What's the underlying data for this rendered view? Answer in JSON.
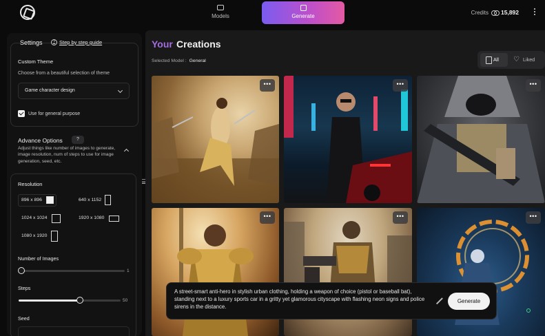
{
  "topbar": {
    "models_label": "Models",
    "generate_label": "Generate",
    "credits_label": "Credits",
    "credits_value": "15,892"
  },
  "sidebar": {
    "title": "Settings",
    "guide_link": "Step by step guide",
    "custom_theme": {
      "title": "Custom Theme",
      "subtitle": "Choose from a beautiful selection of theme",
      "selected": "Game character design",
      "checkbox_label": "Use for general purpose",
      "checkbox_checked": true
    },
    "advance": {
      "title": "Advance Options",
      "badge": "?",
      "description": "Adjust things like number of images to generate, image resolution, num of steps to use for image generation, seed, etc."
    },
    "resolution": {
      "title": "Resolution",
      "options": [
        "896 x 896",
        "640 x 1152",
        "1024 x 1024",
        "1920 x 1080",
        "1080 x 1920"
      ]
    },
    "num_images": {
      "label": "Number of Images",
      "value": 1,
      "max_label": "1"
    },
    "steps": {
      "label": "Steps",
      "value": 30,
      "max": 50,
      "max_label": "50"
    },
    "seed": {
      "label": "Seed"
    }
  },
  "main": {
    "title_accent": "Your",
    "title_rest": "Creations",
    "selected_model_label": "Selected Model :",
    "selected_model_value": "General",
    "filters": {
      "all": "All",
      "liked": "Liked"
    },
    "tile_menu": "•••",
    "images": [
      "desert-warrior-image",
      "cyberpunk-antihero-image",
      "masked-soldier-image",
      "golden-armored-knight-image",
      "steampunk-soldier-image",
      "cosmic-wizard-image"
    ],
    "prompt": "A street-smart anti-hero in stylish urban clothing, holding a weapon of choice (pistol or baseball bat), standing next to a luxury sports car in a gritty yet glamorous cityscape with flashing neon signs and police sirens in the distance.",
    "generate_button": "Generate"
  },
  "colors": {
    "accent_purple": "#a46de0",
    "generate_gradient_start": "#7a5cf0",
    "generate_gradient_end": "#e35aa2",
    "background": "#0b0b0c"
  }
}
